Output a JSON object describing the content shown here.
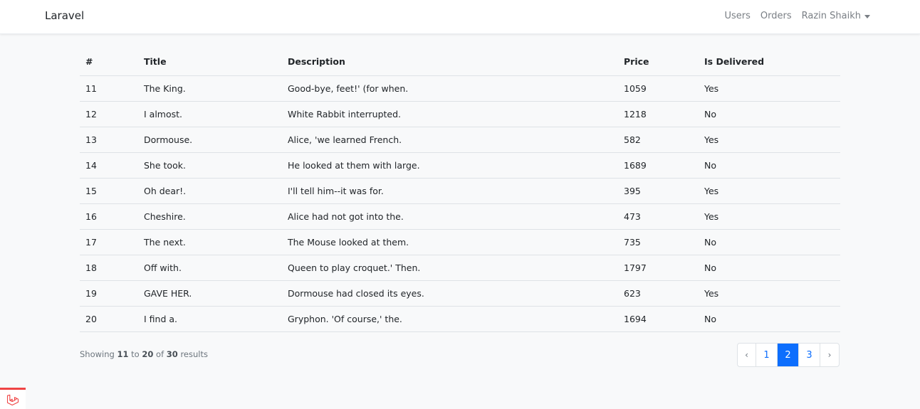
{
  "navbar": {
    "brand": "Laravel",
    "links": [
      "Users",
      "Orders"
    ],
    "user_name": "Razin Shaikh"
  },
  "table": {
    "headers": [
      "#",
      "Title",
      "Description",
      "Price",
      "Is Delivered"
    ],
    "rows": [
      [
        "11",
        "The King.",
        "Good-bye, feet!' (for when.",
        "1059",
        "Yes"
      ],
      [
        "12",
        "I almost.",
        "White Rabbit interrupted.",
        "1218",
        "No"
      ],
      [
        "13",
        "Dormouse.",
        "Alice, 'we learned French.",
        "582",
        "Yes"
      ],
      [
        "14",
        "She took.",
        "He looked at them with large.",
        "1689",
        "No"
      ],
      [
        "15",
        "Oh dear!.",
        "I'll tell him--it was for.",
        "395",
        "Yes"
      ],
      [
        "16",
        "Cheshire.",
        "Alice had not got into the.",
        "473",
        "Yes"
      ],
      [
        "17",
        "The next.",
        "The Mouse looked at them.",
        "735",
        "No"
      ],
      [
        "18",
        "Off with.",
        "Queen to play croquet.' Then.",
        "1797",
        "No"
      ],
      [
        "19",
        "GAVE HER.",
        "Dormouse had closed its eyes.",
        "623",
        "Yes"
      ],
      [
        "20",
        "I find a.",
        "Gryphon. 'Of course,' the.",
        "1694",
        "No"
      ]
    ]
  },
  "summary": {
    "prefix": "Showing",
    "from": "11",
    "to_word": "to",
    "to": "20",
    "of_word": "of",
    "total": "30",
    "suffix": "results"
  },
  "pagination": {
    "prev": "‹",
    "pages": [
      "1",
      "2",
      "3"
    ],
    "active_page": "2",
    "next": "›"
  },
  "colors": {
    "accent": "#0d6efd",
    "laravel": "#ef4444"
  },
  "icons": {
    "badge": "laravel-logo-icon"
  }
}
